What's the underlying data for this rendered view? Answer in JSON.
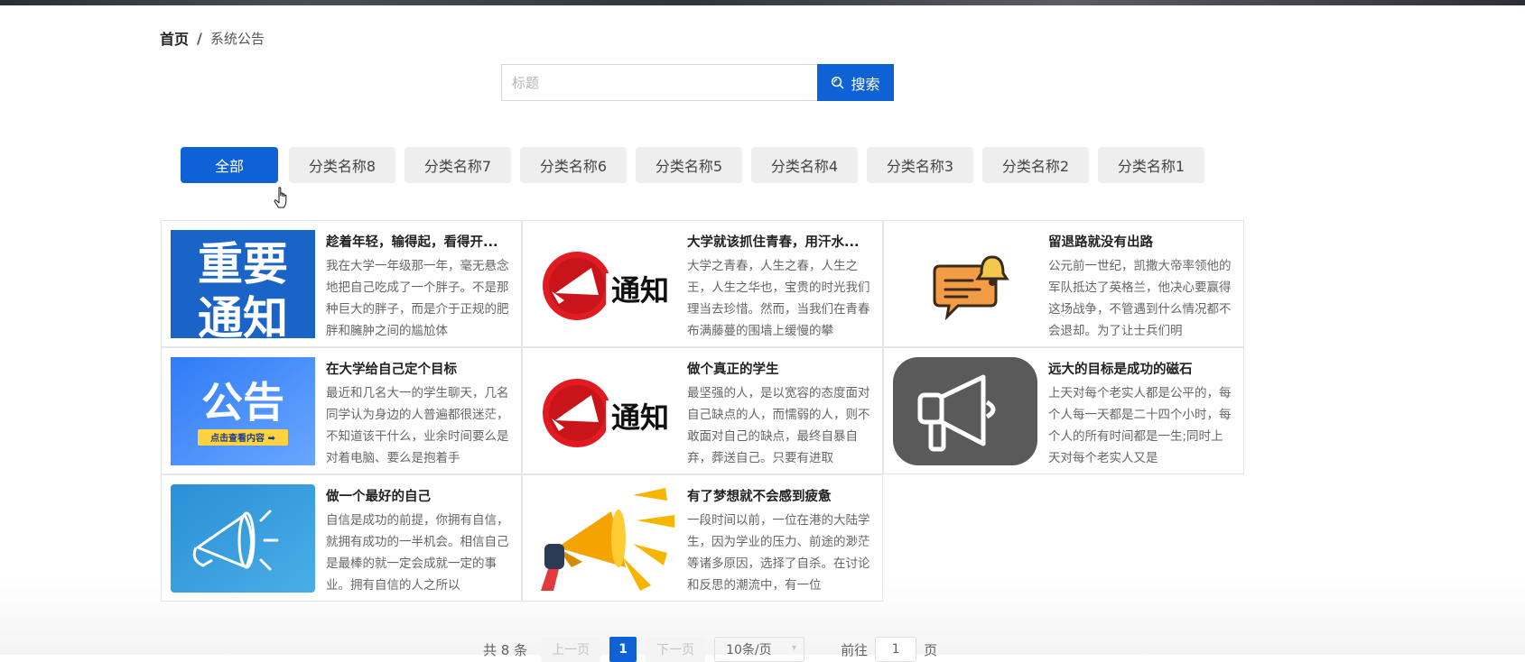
{
  "breadcrumb": {
    "home": "首页",
    "separator": "/",
    "current": "系统公告"
  },
  "search": {
    "placeholder": "标题",
    "value": "",
    "button_label": "搜索"
  },
  "tabs": [
    "全部",
    "分类名称8",
    "分类名称7",
    "分类名称6",
    "分类名称5",
    "分类名称4",
    "分类名称3",
    "分类名称2",
    "分类名称1"
  ],
  "active_tab": "全部",
  "notices": [
    {
      "title": "趁着年轻，输得起，看得开...",
      "desc": "我在大学一年级那一年，毫无悬念地把自己吃成了一个胖子。不是那种巨大的胖子，而是介于正规的肥胖和臃肿之间的尴尬体",
      "image": "important-notice-image",
      "badge_text": [
        "重要",
        "通知"
      ]
    },
    {
      "title": "大学就该抓住青春，用汗水...",
      "desc": "大学之青春，人生之春，人生之王，人生之华也，宝贵的时光我们理当去珍惜。然而，当我们在青春布满藤蔓的围墙上缓慢的攀",
      "image": "notice-megaphone-image",
      "badge_text": [
        "通知"
      ]
    },
    {
      "title": "留退路就没有出路",
      "desc": "公元前一世纪，凯撒大帝率领他的军队抵达了英格兰，他决心要赢得这场战争，不管遇到什么情况都不会退却。为了让士兵们明",
      "image": "chat-bell-image"
    },
    {
      "title": "在大学给自己定个目标",
      "desc": "最近和几名大一的学生聊天，几名同学认为身边的人普遍都很迷茫，不知道该干什么，业余时间要么是对着电脑、要么是抱着手",
      "image": "announcement-image",
      "badge_text": [
        "公告",
        "点击查看内容 ➡"
      ]
    },
    {
      "title": "做个真正的学生",
      "desc": "最坚强的人，是以宽容的态度面对自己缺点的人，而懦弱的人，则不敢面对自己的缺点，最终自暴自弃，葬送自己。只要有进取",
      "image": "notice-megaphone-image",
      "badge_text": [
        "通知"
      ]
    },
    {
      "title": "远大的目标是成功的磁石",
      "desc": "上天对每个老实人都是公平的，每个人每一天都是二十四个小时，每个人的所有时间都是一生;同时上天对每个老实人又是",
      "image": "megaphone-dark-image"
    },
    {
      "title": "做一个最好的自己",
      "desc": "自信是成功的前提，你拥有自信，就拥有成功的一半机会。相信自己是最棒的就一定会成就一定的事业。拥有自信的人之所以",
      "image": "megaphone-outline-image"
    },
    {
      "title": "有了梦想就不会感到疲惫",
      "desc": "一段时间以前，一位在港的大陆学生，因为学业的压力、前途的渺茫等诸多原因，选择了自杀。在讨论和反思的潮流中，有一位",
      "image": "megaphone-yellow-image"
    }
  ],
  "pagination": {
    "total_text": "共 8 条",
    "prev": "上一页",
    "current_page": "1",
    "next": "下一页",
    "page_size": "10条/页",
    "goto_label": "前往",
    "goto_value": "1",
    "page_unit": "页"
  },
  "colors": {
    "primary": "#0f62d6",
    "tab_bg": "#eeeeee",
    "card_border": "#e6e6e6"
  }
}
